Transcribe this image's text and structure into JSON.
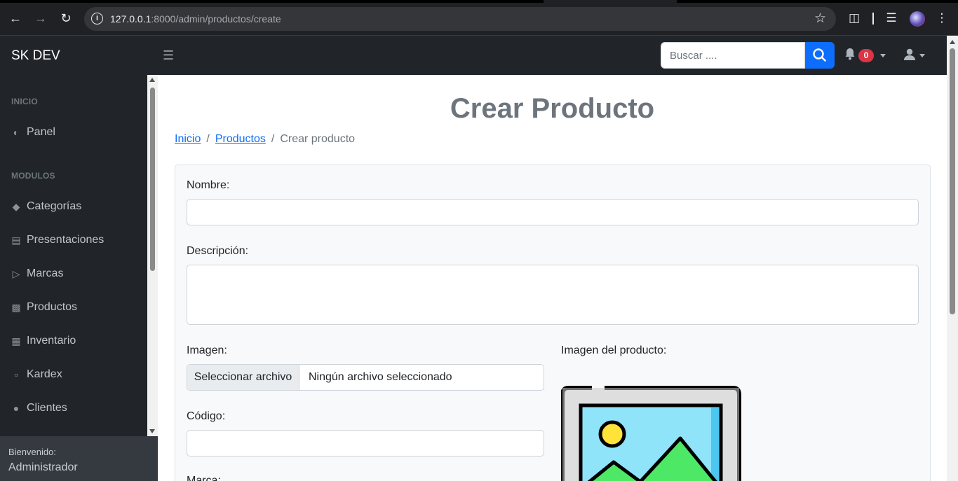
{
  "browser": {
    "url_host": "127.0.0.1",
    "url_rest": ":8000/admin/productos/create"
  },
  "navbar": {
    "brand": "SK DEV",
    "search_placeholder": "Buscar ....",
    "notification_count": "0"
  },
  "sidebar": {
    "sections": [
      {
        "heading": "INICIO",
        "items": [
          {
            "label": "Panel",
            "icon": "palette-icon"
          }
        ]
      },
      {
        "heading": "MODULOS",
        "items": [
          {
            "label": "Categorías",
            "icon": "tag-icon"
          },
          {
            "label": "Presentaciones",
            "icon": "box-icon"
          },
          {
            "label": "Marcas",
            "icon": "bullhorn-icon"
          },
          {
            "label": "Productos",
            "icon": "bag-icon"
          },
          {
            "label": "Inventario",
            "icon": "book-icon"
          },
          {
            "label": "Kardex",
            "icon": "file-icon"
          },
          {
            "label": "Clientes",
            "icon": "users-icon"
          }
        ]
      }
    ],
    "footer": {
      "greeting": "Bienvenido:",
      "user": "Administrador"
    }
  },
  "main": {
    "title": "Crear Producto",
    "breadcrumb": [
      {
        "label": "Inicio",
        "link": true
      },
      {
        "label": "Productos",
        "link": true
      },
      {
        "label": "Crear producto",
        "link": false
      }
    ],
    "form": {
      "nombre_label": "Nombre:",
      "descripcion_label": "Descripción:",
      "imagen_label": "Imagen:",
      "file_button": "Seleccionar archivo",
      "file_status": "Ningún archivo seleccionado",
      "preview_label": "Imagen del producto:",
      "codigo_label": "Código:",
      "marca_label": "Marca:"
    }
  },
  "colors": {
    "navbar_bg": "#212529",
    "primary": "#0d6efd",
    "badge": "#dc3545"
  }
}
